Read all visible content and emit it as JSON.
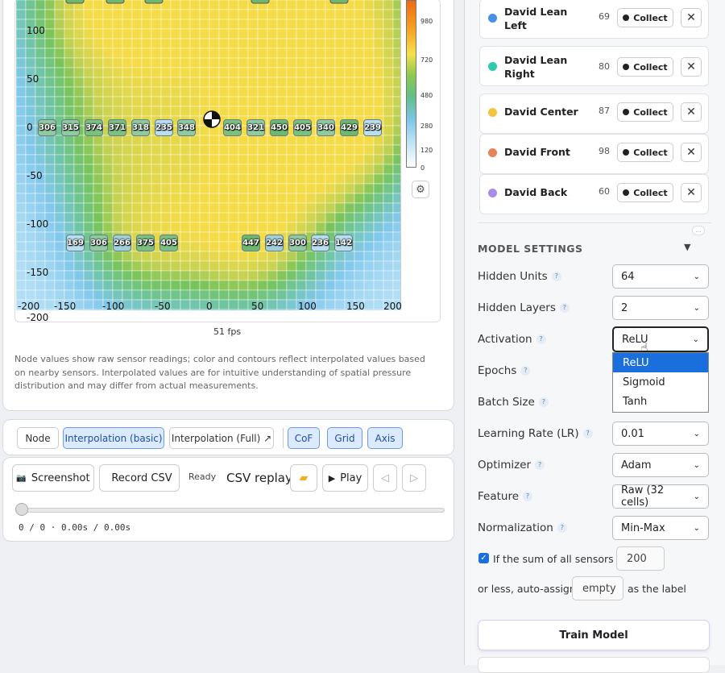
{
  "heatmap": {
    "y_ticks": [
      "100",
      "50",
      "0",
      "-50",
      "-100",
      "-150",
      "-200"
    ],
    "x_ticks": [
      "-200",
      "-150",
      "-100",
      "-50",
      "0",
      "50",
      "100",
      "150",
      "200"
    ],
    "colorbar_ticks": [
      "980",
      "720",
      "480",
      "280",
      "120",
      "0"
    ],
    "row_zero": [
      "306",
      "315",
      "374",
      "371",
      "318",
      "235",
      "348",
      "404",
      "321",
      "450",
      "405",
      "340",
      "429",
      "239"
    ],
    "row_minus_hundred": [
      "169",
      "306",
      "266",
      "375",
      "405",
      "447",
      "242",
      "300",
      "236",
      "142"
    ],
    "fps": "51  fps",
    "note": "Node values show raw sensor readings; color and contours reflect interpolated values based on nearby sensors. Interpolated values are for intuitive understanding of spatial pressure distribution and may differ from actual measurements."
  },
  "toolbar": {
    "node": "Node",
    "interp_basic": "Interpolation (basic)",
    "interp_full": "Interpolation (Full) ↗",
    "cof": "CoF",
    "grid": "Grid",
    "axis": "Axis"
  },
  "replay": {
    "screenshot": "Screenshot",
    "record_csv": "Record CSV",
    "status": "Ready",
    "title": "CSV replay",
    "play": "Play",
    "progress": "0 / 0 · 0.00s / 0.00s"
  },
  "labels": [
    {
      "name": "David Lean Left",
      "count": "69",
      "color": "#4a8fe6"
    },
    {
      "name": "David Lean Right",
      "count": "80",
      "color": "#2ec9b0"
    },
    {
      "name": "David Center",
      "count": "87",
      "color": "#f2c53d"
    },
    {
      "name": "David Front",
      "count": "98",
      "color": "#e8835a"
    },
    {
      "name": "David Back",
      "count": "60",
      "color": "#a98be8"
    }
  ],
  "collect_label": "Collect",
  "model": {
    "title": "MODEL SETTINGS",
    "hidden_units": {
      "label": "Hidden Units",
      "value": "64"
    },
    "hidden_layers": {
      "label": "Hidden Layers",
      "value": "2"
    },
    "activation": {
      "label": "Activation",
      "value": "ReLU",
      "options": [
        "ReLU",
        "Sigmoid",
        "Tanh"
      ]
    },
    "epochs": {
      "label": "Epochs"
    },
    "batch_size": {
      "label": "Batch Size"
    },
    "learning_rate": {
      "label": "Learning Rate (LR)",
      "value": "0.01"
    },
    "optimizer": {
      "label": "Optimizer",
      "value": "Adam"
    },
    "feature": {
      "label": "Feature",
      "value": "Raw (32 cells)"
    },
    "normalization": {
      "label": "Normalization",
      "value": "Min-Max"
    },
    "auto_assign": {
      "checkbox_text": "If the sum of all sensors is",
      "threshold": "200",
      "less_text": "or less, auto-assign",
      "label_value": "empty",
      "suffix": "as the label"
    },
    "train": "Train Model"
  }
}
